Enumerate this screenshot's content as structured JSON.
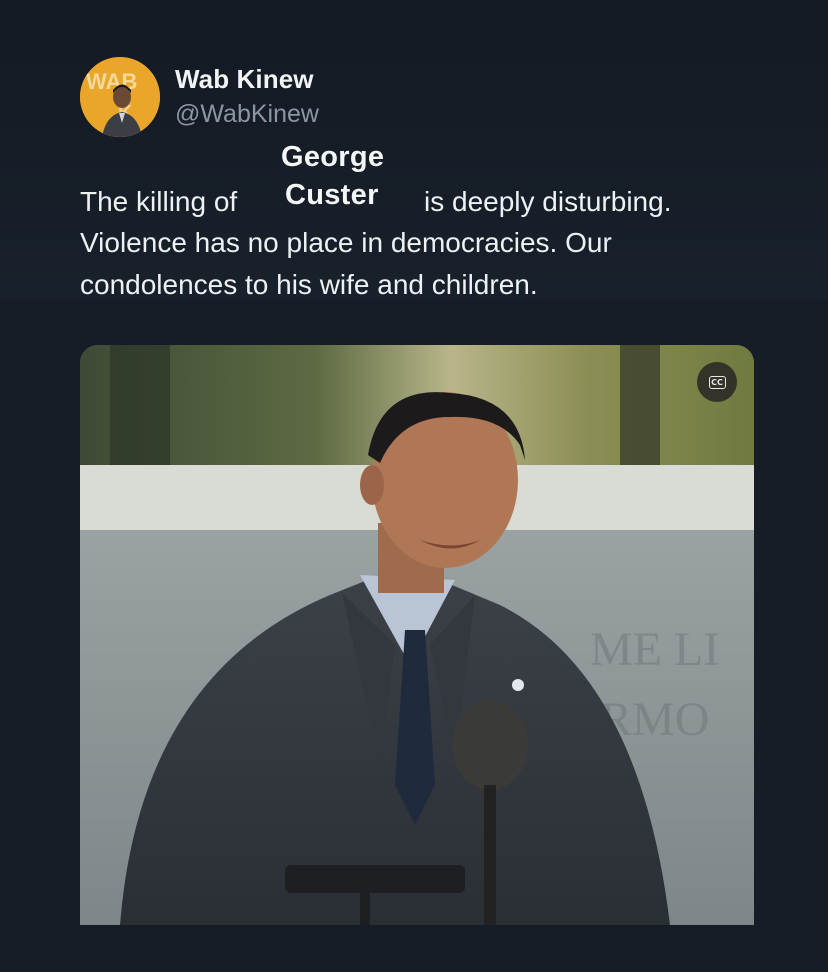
{
  "tweet": {
    "display_name": "Wab Kinew",
    "handle": "@WabKinew",
    "avatar": {
      "icon": "profile-photo",
      "ring_color": "#e6a32a"
    },
    "text_line1_before": "The killing of",
    "text_line1_after": "is deeply disturbing.",
    "text_line2": "Violence has no place in democracies. Our",
    "text_line3": "condolences to his wife and children.",
    "overlay_name_first": "George",
    "overlay_name_last": "Custer"
  },
  "media": {
    "type": "video",
    "cc_label": "CC",
    "cc_icon": "closed-captions-icon"
  },
  "colors": {
    "background": "#161d27",
    "text": "#eef1f4",
    "secondary_text": "#8b96a3"
  }
}
